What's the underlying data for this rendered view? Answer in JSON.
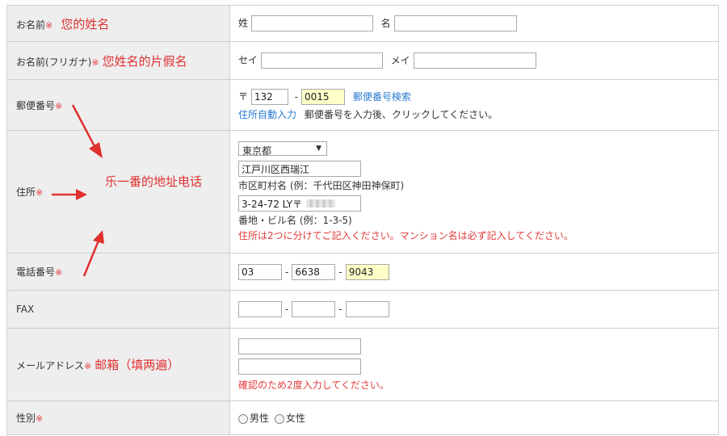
{
  "required_mark": "※",
  "rows": {
    "name": {
      "label": "お名前",
      "note": "您的姓名",
      "sei_label": "姓",
      "mei_label": "名",
      "sei_value": "",
      "mei_value": ""
    },
    "kana": {
      "label": "お名前(フリガナ)",
      "note": "您姓名的片假名",
      "sei_label": "セイ",
      "mei_label": "メイ",
      "sei_value": "",
      "mei_value": ""
    },
    "postal": {
      "label": "郵便番号",
      "prefix": "〒",
      "part1": "132",
      "part2": "0015",
      "dash": "-",
      "search_link": "郵便番号検索",
      "auto_link": "住所自動入力",
      "auto_desc": "郵便番号を入力後、クリックしてください。"
    },
    "address": {
      "label": "住所",
      "prefecture": "東京都",
      "city_value": "江戸川区西瑞江",
      "city_hint": "市区町村名 (例：千代田区神田神保町)",
      "street_value": "3-24-72 LY〒",
      "street_hint": "番地・ビル名 (例：1-3-5)",
      "warning": "住所は2つに分けてご記入ください。マンション名は必ず記入してください。"
    },
    "phone": {
      "label": "電話番号",
      "part1": "03",
      "part2": "6638",
      "part3": "9043",
      "dash": "-"
    },
    "fax": {
      "label": "FAX",
      "part1": "",
      "part2": "",
      "part3": "",
      "dash": "-"
    },
    "email": {
      "label": "メールアドレス",
      "note": "邮箱（填两遍）",
      "value1": "",
      "value2": "",
      "warning": "確認のため2度入力してください。"
    },
    "gender": {
      "label": "性別",
      "male": "男性",
      "female": "女性"
    }
  },
  "annotation_center": "乐一番的地址电话",
  "colors": {
    "required": "#e23b3b",
    "annotation": "#e03030",
    "link": "#2a7bd0",
    "highlight_input": "#ffffc8",
    "label_bg": "#eeeeee"
  }
}
